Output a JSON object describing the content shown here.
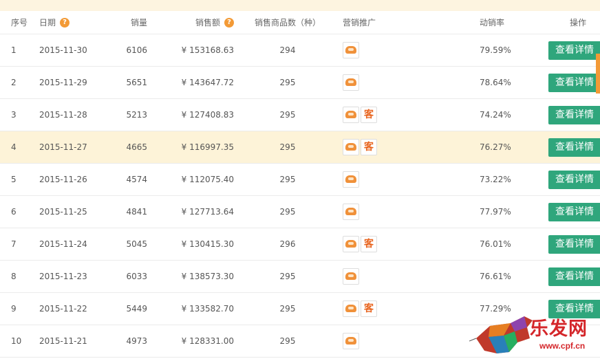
{
  "header": {
    "idx": "序号",
    "date": "日期",
    "qty": "销量",
    "amount": "销售额",
    "count": "销售商品数（种）",
    "promo": "营销推广",
    "rate": "动销率",
    "op": "操作",
    "help_glyph": "?"
  },
  "ke_label": "客",
  "detail_label": "查看详情",
  "watermark": {
    "text": "乐发网",
    "url": "www.cpf.cn"
  },
  "rows": [
    {
      "idx": "1",
      "date": "2015-11-30",
      "qty": "6106",
      "amount": "¥ 153168.63",
      "count": "294",
      "rate": "79.59%",
      "ke": false
    },
    {
      "idx": "2",
      "date": "2015-11-29",
      "qty": "5651",
      "amount": "¥ 143647.72",
      "count": "295",
      "rate": "78.64%",
      "ke": false
    },
    {
      "idx": "3",
      "date": "2015-11-28",
      "qty": "5213",
      "amount": "¥ 127408.83",
      "count": "295",
      "rate": "74.24%",
      "ke": true
    },
    {
      "idx": "4",
      "date": "2015-11-27",
      "qty": "4665",
      "amount": "¥ 116997.35",
      "count": "295",
      "rate": "76.27%",
      "ke": true
    },
    {
      "idx": "5",
      "date": "2015-11-26",
      "qty": "4574",
      "amount": "¥ 112075.40",
      "count": "295",
      "rate": "73.22%",
      "ke": false
    },
    {
      "idx": "6",
      "date": "2015-11-25",
      "qty": "4841",
      "amount": "¥ 127713.64",
      "count": "295",
      "rate": "77.97%",
      "ke": false
    },
    {
      "idx": "7",
      "date": "2015-11-24",
      "qty": "5045",
      "amount": "¥ 130415.30",
      "count": "296",
      "rate": "76.01%",
      "ke": true
    },
    {
      "idx": "8",
      "date": "2015-11-23",
      "qty": "6033",
      "amount": "¥ 138573.30",
      "count": "295",
      "rate": "76.61%",
      "ke": false
    },
    {
      "idx": "9",
      "date": "2015-11-22",
      "qty": "5449",
      "amount": "¥ 133582.70",
      "count": "295",
      "rate": "77.29%",
      "ke": true
    },
    {
      "idx": "10",
      "date": "2015-11-21",
      "qty": "4973",
      "amount": "¥ 128331.00",
      "count": "295",
      "rate": "",
      "ke": false
    }
  ],
  "colors": {
    "button": "#2fa67c",
    "highlight_row": "#fdf3d8",
    "help_badge": "#f39a36",
    "ke_text": "#e8641e",
    "watermark": "#d4262a"
  }
}
